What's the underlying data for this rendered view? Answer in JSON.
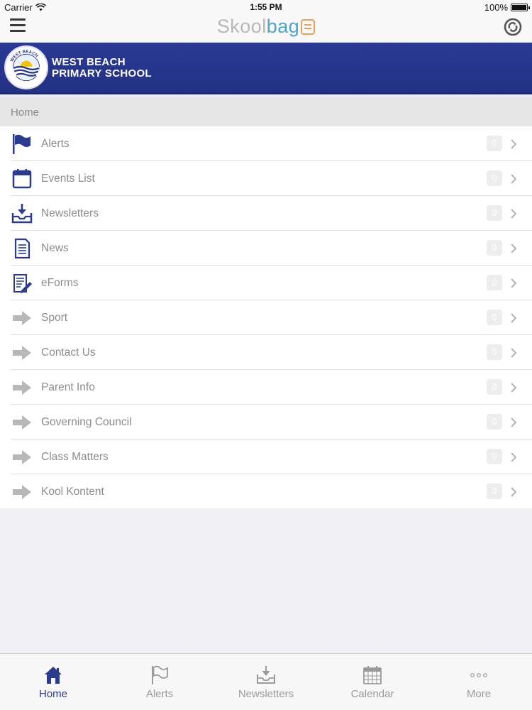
{
  "status_bar": {
    "carrier": "Carrier",
    "time": "1:55 PM",
    "battery": "100%"
  },
  "nav_bar": {
    "logo_part1": "Skool",
    "logo_part2": "bag",
    "menu_icon": "hamburger-menu-icon",
    "refresh_icon": "sync-icon"
  },
  "school": {
    "name_line1": "WEST BEACH",
    "name_line2": "PRIMARY SCHOOL",
    "crest_text": "WEST BEACH PRIMARY SCHOOL"
  },
  "breadcrumb": "Home",
  "menu": {
    "items": [
      {
        "label": "Alerts",
        "icon": "flag-icon",
        "badge": "0"
      },
      {
        "label": "Events List",
        "icon": "calendar-icon",
        "badge": "0"
      },
      {
        "label": "Newsletters",
        "icon": "inbox-download-icon",
        "badge": "0"
      },
      {
        "label": "News",
        "icon": "document-icon",
        "badge": "0"
      },
      {
        "label": "eForms",
        "icon": "form-edit-icon",
        "badge": "0"
      },
      {
        "label": "Sport",
        "icon": "arrow-right-icon",
        "badge": "0"
      },
      {
        "label": "Contact Us",
        "icon": "arrow-right-icon",
        "badge": "0"
      },
      {
        "label": "Parent Info",
        "icon": "arrow-right-icon",
        "badge": "0"
      },
      {
        "label": "Governing Council",
        "icon": "arrow-right-icon",
        "badge": "0"
      },
      {
        "label": "Class Matters",
        "icon": "arrow-right-icon",
        "badge": "0"
      },
      {
        "label": "Kool Kontent",
        "icon": "arrow-right-icon",
        "badge": "0"
      }
    ]
  },
  "tab_bar": {
    "tabs": [
      {
        "label": "Home",
        "icon": "home-icon",
        "active": true
      },
      {
        "label": "Alerts",
        "icon": "flag-icon",
        "active": false
      },
      {
        "label": "Newsletters",
        "icon": "inbox-download-icon",
        "active": false
      },
      {
        "label": "Calendar",
        "icon": "calendar-grid-icon",
        "active": false
      },
      {
        "label": "More",
        "icon": "more-dots-icon",
        "active": false
      }
    ]
  },
  "colors": {
    "brand_blue": "#2a3a95",
    "icon_blue": "#2b3c8f",
    "arrow_gray": "#b8b8b8",
    "logo_gray": "#b8b8b8",
    "logo_teal": "#4aa6c9",
    "background": "#efeff4"
  }
}
